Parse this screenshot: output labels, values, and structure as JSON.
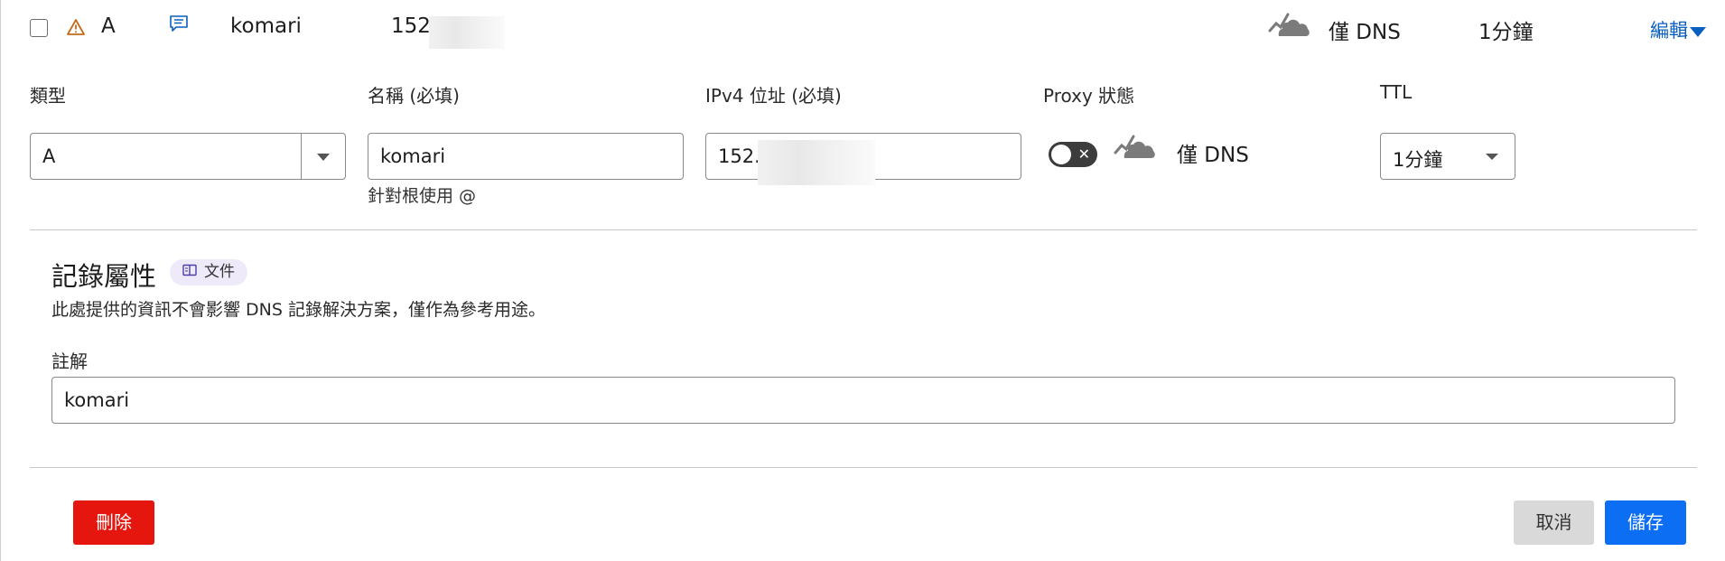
{
  "record": {
    "type": "A",
    "name": "komari",
    "content": "152.",
    "proxy_status": "僅 DNS",
    "ttl": "1分鐘",
    "edit_label": "編輯"
  },
  "form": {
    "type_label": "類型",
    "type_value": "A",
    "name_label": "名稱 (必填)",
    "name_value": "komari",
    "name_hint": "針對根使用 @",
    "ipv4_label": "IPv4 位址 (必填)",
    "ipv4_value": "152.",
    "proxy_label": "Proxy 狀態",
    "proxy_value": "僅 DNS",
    "ttl_label": "TTL",
    "ttl_value": "1分鐘"
  },
  "attributes": {
    "title": "記錄屬性",
    "doc_label": "文件",
    "description": "此處提供的資訊不會影響 DNS 記錄解決方案，僅作為參考用途。",
    "comment_label": "註解",
    "comment_value": "komari"
  },
  "actions": {
    "delete": "刪除",
    "cancel": "取消",
    "save": "儲存"
  },
  "icons": {
    "warning": "warning-icon",
    "comment": "comment-icon",
    "cloud": "cloud-dns-only-icon",
    "book": "book-icon"
  },
  "colors": {
    "link": "#0b5fbf",
    "delete": "#e4160d",
    "save": "#0b6ef3",
    "warning": "#c46a1a"
  }
}
